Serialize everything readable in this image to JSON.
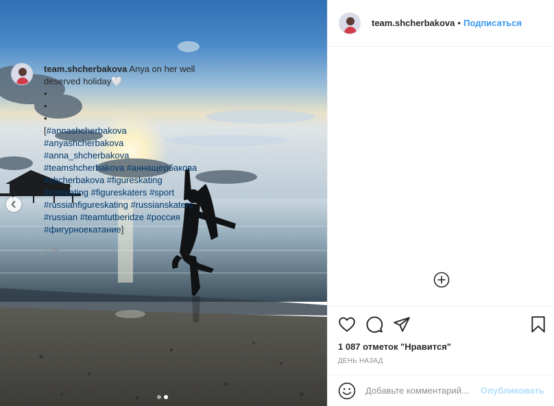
{
  "post": {
    "username": "team.shcherbakova",
    "separator": "•",
    "follow_label": "Подписаться"
  },
  "caption": {
    "username": "team.shcherbakova",
    "text_line1": "Anya on her well",
    "text_line2": "deserved holiday🤍",
    "bullets": [
      "•",
      "•",
      "•"
    ],
    "lines": [
      [
        {
          "text": "[",
          "tag": false
        },
        {
          "text": "#annashcherbakova",
          "tag": true
        }
      ],
      [
        {
          "text": "#anyashcherbakova",
          "tag": true
        }
      ],
      [
        {
          "text": "#anna_shcherbakova",
          "tag": true
        }
      ],
      [
        {
          "text": "#teamshcherbakova",
          "tag": true
        },
        {
          "text": " ",
          "tag": false
        },
        {
          "text": "#аннащербакова",
          "tag": true
        }
      ],
      [
        {
          "text": "#shcherbakova",
          "tag": true
        },
        {
          "text": " ",
          "tag": false
        },
        {
          "text": "#figureskating",
          "tag": true
        }
      ],
      [
        {
          "text": "#iceskating",
          "tag": true
        },
        {
          "text": " ",
          "tag": false
        },
        {
          "text": "#figureskaters",
          "tag": true
        },
        {
          "text": " ",
          "tag": false
        },
        {
          "text": "#sport",
          "tag": true
        }
      ],
      [
        {
          "text": "#russianfigureskating",
          "tag": true
        },
        {
          "text": " ",
          "tag": false
        },
        {
          "text": "#russianskaters",
          "tag": true
        }
      ],
      [
        {
          "text": "#russian",
          "tag": true
        },
        {
          "text": " ",
          "tag": false
        },
        {
          "text": "#teamtutberidze",
          "tag": true
        },
        {
          "text": " ",
          "tag": false
        },
        {
          "text": "#россия",
          "tag": true
        }
      ],
      [
        {
          "text": "#фигурноекатание",
          "tag": true
        },
        {
          "text": "]",
          "tag": false
        }
      ]
    ],
    "time": "1 дн."
  },
  "actions": {
    "likes": "1 087 отметок \"Нравится\"",
    "date": "ДЕНЬ НАЗАД"
  },
  "comment": {
    "placeholder": "Добавьте комментарий...",
    "post_label": "Опубликовать"
  },
  "carousel": {
    "slides": 2,
    "active_index": 1
  },
  "colors": {
    "link_blue": "#3897f0",
    "hashtag": "#00376b",
    "muted": "#8e8e8e",
    "post_disabled": "#b2dffc"
  },
  "icons": [
    "chevron-left-icon",
    "add-circle-icon",
    "heart-icon",
    "comment-icon",
    "share-icon",
    "bookmark-icon",
    "smiley-icon"
  ]
}
